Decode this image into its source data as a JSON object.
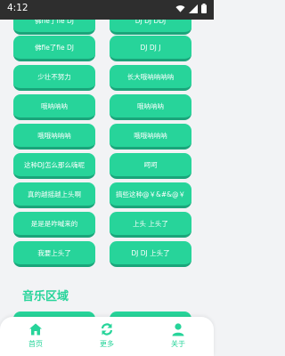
{
  "status": {
    "time": "4:12"
  },
  "buttons": [
    {
      "label": "佛fie了fie DJ"
    },
    {
      "label": "DJ DJ DDJ"
    },
    {
      "label": "佛fie了fie DJ"
    },
    {
      "label": "DJ DJ J"
    },
    {
      "label": "少壮不努力"
    },
    {
      "label": "长大哦呐呐呐呐"
    },
    {
      "label": "哦呐呐呐"
    },
    {
      "label": "哦呐呐呐"
    },
    {
      "label": "哦哦呐呐呐"
    },
    {
      "label": "哦哦呐呐呐"
    },
    {
      "label": "这种DJ怎么那么嗨呢"
    },
    {
      "label": "呵呵"
    },
    {
      "label": "真的越摇越上头啊"
    },
    {
      "label": "搞些这种@￥&#&@￥"
    },
    {
      "label": "是是是咋喊来的"
    },
    {
      "label": "上头 上头了"
    },
    {
      "label": "我要上头了"
    },
    {
      "label": "DJ DJ 上头了"
    }
  ],
  "section": {
    "title": "音乐区域"
  },
  "nav": {
    "home": "首页",
    "more": "更多",
    "about": "关于"
  },
  "colors": {
    "accent": "#27d49a",
    "accent_dark": "#1aa57a"
  }
}
